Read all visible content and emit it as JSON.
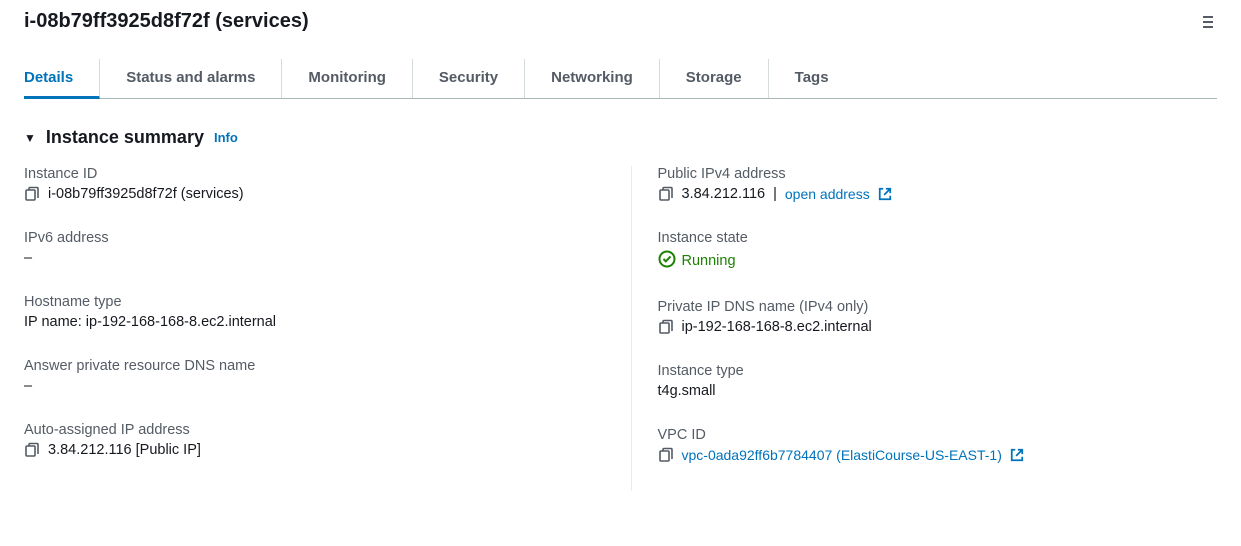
{
  "header": {
    "title": "i-08b79ff3925d8f72f (services)"
  },
  "tabs": {
    "items": [
      {
        "label": "Details",
        "active": true
      },
      {
        "label": "Status and alarms",
        "active": false
      },
      {
        "label": "Monitoring",
        "active": false
      },
      {
        "label": "Security",
        "active": false
      },
      {
        "label": "Networking",
        "active": false
      },
      {
        "label": "Storage",
        "active": false
      },
      {
        "label": "Tags",
        "active": false
      }
    ]
  },
  "section": {
    "title": "Instance summary",
    "info": "Info"
  },
  "fields": {
    "instance_id": {
      "label": "Instance ID",
      "value": "i-08b79ff3925d8f72f (services)"
    },
    "public_ipv4": {
      "label": "Public IPv4 address",
      "value": "3.84.212.116",
      "separator": " | ",
      "link": "open address"
    },
    "ipv6": {
      "label": "IPv6 address",
      "value": "–"
    },
    "instance_state": {
      "label": "Instance state",
      "value": "Running"
    },
    "hostname_type": {
      "label": "Hostname type",
      "value": "IP name: ip-192-168-168-8.ec2.internal"
    },
    "private_ip_dns": {
      "label": "Private IP DNS name (IPv4 only)",
      "value": "ip-192-168-168-8.ec2.internal"
    },
    "answer_private_dns": {
      "label": "Answer private resource DNS name",
      "value": "–"
    },
    "instance_type": {
      "label": "Instance type",
      "value": "t4g.small"
    },
    "auto_assigned_ip": {
      "label": "Auto-assigned IP address",
      "value": "3.84.212.116 [Public IP]"
    },
    "vpc_id": {
      "label": "VPC ID",
      "value": "vpc-0ada92ff6b7784407 (ElastiCourse-US-EAST-1)"
    }
  }
}
